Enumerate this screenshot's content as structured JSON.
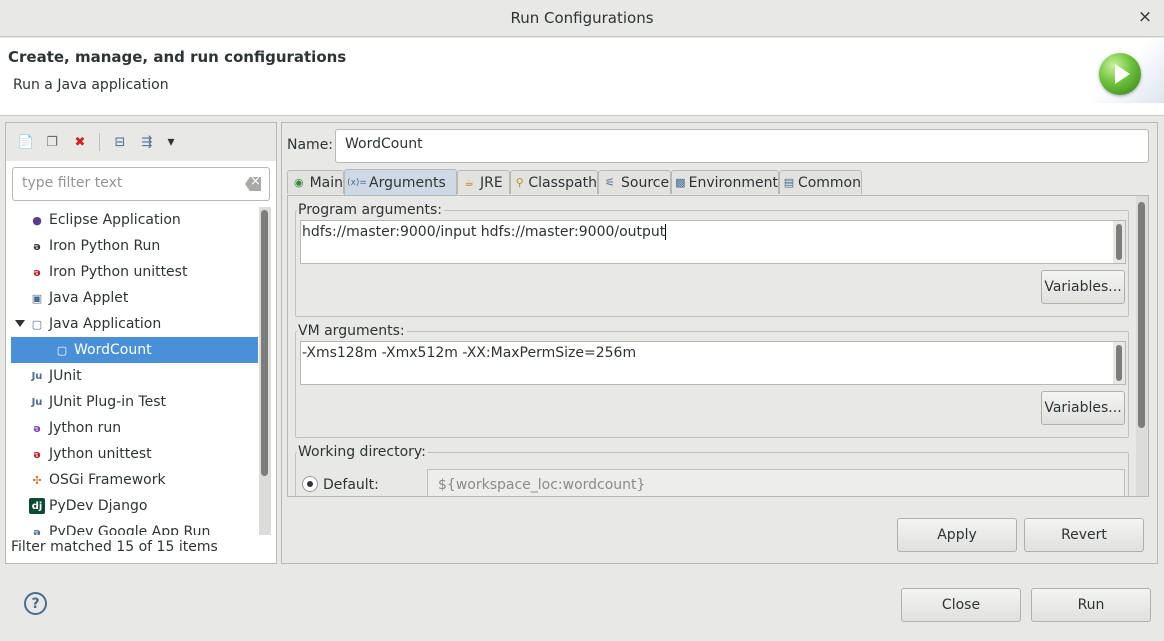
{
  "window": {
    "title": "Run Configurations",
    "close_glyph": "×"
  },
  "banner": {
    "heading": "Create, manage, and run configurations",
    "subheading": "Run a Java application",
    "icon": "run-play-icon"
  },
  "toolbar": {
    "buttons": [
      {
        "name": "new-configuration-icon",
        "glyph": "📄"
      },
      {
        "name": "duplicate-configuration-icon",
        "glyph": "❐"
      },
      {
        "name": "delete-configuration-icon",
        "glyph": "✖"
      },
      {
        "name": "collapse-all-icon",
        "glyph": "⊟"
      },
      {
        "name": "filter-configurations-icon",
        "glyph": "⇶"
      },
      {
        "name": "view-menu-chevron-icon",
        "glyph": "▾"
      }
    ]
  },
  "filter": {
    "placeholder": "type filter text",
    "status": "Filter matched 15 of 15 items"
  },
  "tree": {
    "items": [
      {
        "label": "Eclipse Application",
        "icon": "eclipse-icon",
        "glyph": "●",
        "color": "#5a3d8a"
      },
      {
        "label": "Iron Python Run",
        "icon": "python-run-icon",
        "glyph": "ǝ",
        "color": "#2e3436"
      },
      {
        "label": "Iron Python unittest",
        "icon": "python-unittest-icon",
        "glyph": "ǝ",
        "color": "#b02020"
      },
      {
        "label": "Java Applet",
        "icon": "java-applet-icon",
        "glyph": "▣",
        "color": "#4a6c8f"
      },
      {
        "label": "Java Application",
        "icon": "java-application-icon",
        "glyph": "▢",
        "color": "#4a6c8f"
      },
      {
        "label": "WordCount",
        "icon": "java-class-icon",
        "glyph": "▢",
        "color": "#ffffff"
      },
      {
        "label": "JUnit",
        "icon": "junit-icon",
        "glyph": "Ju",
        "color": "#4a6c8f"
      },
      {
        "label": "JUnit Plug-in Test",
        "icon": "junit-plugin-icon",
        "glyph": "Ju",
        "color": "#4a6c8f"
      },
      {
        "label": "Jython run",
        "icon": "jython-run-icon",
        "glyph": "ǝ",
        "color": "#7b3fb5"
      },
      {
        "label": "Jython unittest",
        "icon": "jython-unittest-icon",
        "glyph": "ǝ",
        "color": "#b02020"
      },
      {
        "label": "OSGi Framework",
        "icon": "osgi-icon",
        "glyph": "✣",
        "color": "#c87a2a"
      },
      {
        "label": "PyDev Django",
        "icon": "django-icon",
        "glyph": "dj",
        "color": "#ffffff"
      },
      {
        "label": "PyDev Google App Run",
        "icon": "google-app-icon",
        "glyph": "ǝ",
        "color": "#4a6c8f"
      }
    ]
  },
  "config": {
    "name_label": "Name:",
    "name_value": "WordCount",
    "tabs": [
      {
        "label": "Main",
        "icon": "main-tab-icon",
        "glyph": "◉"
      },
      {
        "label": "Arguments",
        "icon": "arguments-tab-icon",
        "glyph": "(x)="
      },
      {
        "label": "JRE",
        "icon": "jre-tab-icon",
        "glyph": "☕"
      },
      {
        "label": "Classpath",
        "icon": "classpath-tab-icon",
        "glyph": "⚲"
      },
      {
        "label": "Source",
        "icon": "source-tab-icon",
        "glyph": "⚟"
      },
      {
        "label": "Environment",
        "icon": "environment-tab-icon",
        "glyph": "▩"
      },
      {
        "label": "Common",
        "icon": "common-tab-icon",
        "glyph": "▤"
      }
    ],
    "program_args": {
      "label": "Program arguments:",
      "value": "hdfs://master:9000/input hdfs://master:9000/output",
      "variables_label": "Variables..."
    },
    "vm_args": {
      "label": "VM arguments:",
      "value": "-Xms128m -Xmx512m -XX:MaxPermSize=256m",
      "variables_label": "Variables..."
    },
    "working_dir": {
      "label": "Working directory:",
      "default_label": "Default:",
      "default_value": "${workspace_loc:wordcount}"
    },
    "apply_label": "Apply",
    "revert_label": "Revert"
  },
  "footer": {
    "help_glyph": "?",
    "close_label": "Close",
    "run_label": "Run"
  }
}
